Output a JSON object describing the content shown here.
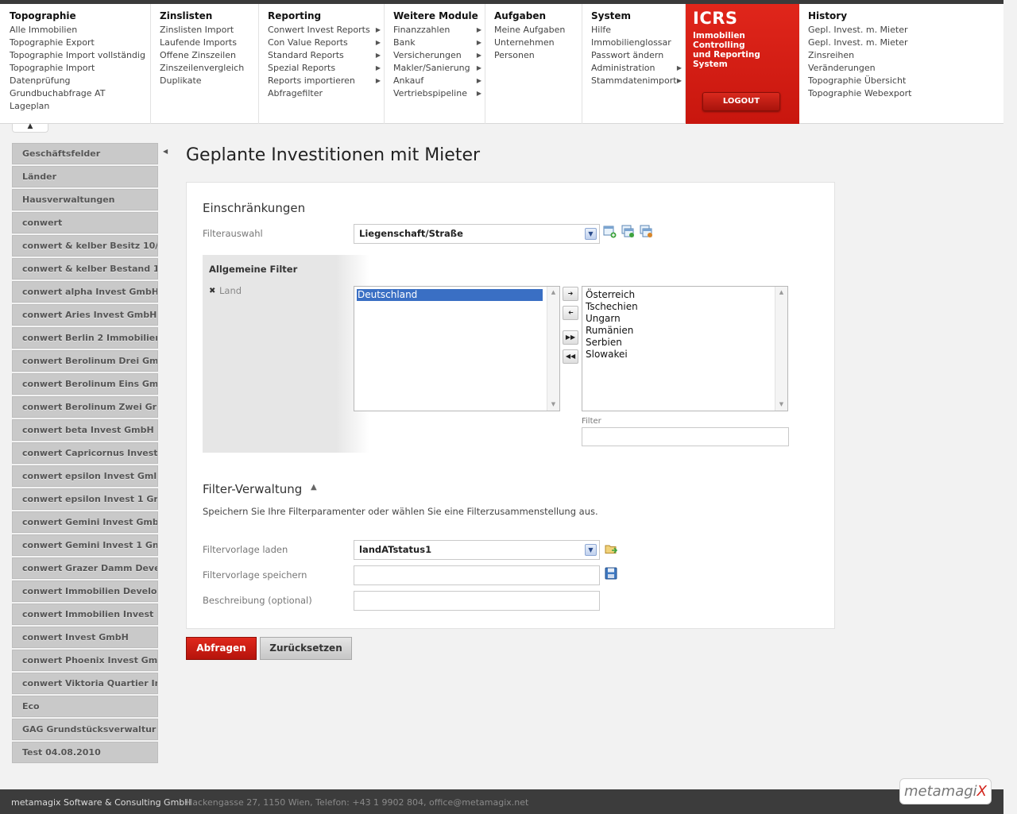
{
  "menu": {
    "topographie": {
      "title": "Topographie",
      "items": [
        "Alle Immobilien",
        "Topographie Export",
        "Topographie Import vollständig",
        "Topographie Import",
        "Datenprüfung",
        "Grundbuchabfrage AT",
        "Lageplan"
      ]
    },
    "zinslisten": {
      "title": "Zinslisten",
      "items": [
        "Zinslisten Import",
        "Laufende Imports",
        "Offene Zinszeilen",
        "Zinszeilenvergleich",
        "Duplikate"
      ]
    },
    "reporting": {
      "title": "Reporting",
      "items": [
        "Conwert Invest Reports",
        "Con Value Reports",
        "Standard Reports",
        "Spezial Reports",
        "Reports importieren",
        "Abfragefilter"
      ]
    },
    "weitere": {
      "title": "Weitere Module",
      "items": [
        "Finanzzahlen",
        "Bank",
        "Versicherungen",
        "Makler/Sanierung",
        "Ankauf",
        "Vertriebspipeline"
      ]
    },
    "aufgaben": {
      "title": "Aufgaben",
      "items": [
        "Meine Aufgaben",
        "Unternehmen",
        "Personen"
      ]
    },
    "system": {
      "title": "System",
      "items": [
        "Hilfe",
        "Immobilienglossar",
        "Passwort ändern",
        "Administration",
        "Stammdatenimport"
      ]
    },
    "history": {
      "title": "History",
      "items": [
        "Gepl. Invest. m. Mieter",
        "Gepl. Invest. m. Mieter",
        "Zinsreihen",
        "Veränderungen",
        "Topographie Übersicht",
        "Topographie Webexport"
      ]
    }
  },
  "icrs": {
    "title": "ICRS",
    "subtitle_line1": "Immobilien Controlling",
    "subtitle_line2": "und Reporting System",
    "logout": "LOGOUT"
  },
  "sidebar": {
    "items": [
      "Geschäftsfelder",
      "Länder",
      "Hausverwaltungen",
      "conwert",
      "conwert & kelber Besitz 10/",
      "conwert & kelber Bestand 1",
      "conwert alpha Invest GmbH",
      "conwert Aries Invest GmbH",
      "conwert Berlin 2 Immobilier",
      "conwert Berolinum Drei Gm",
      "conwert Berolinum Eins Gm",
      "conwert Berolinum Zwei Gr",
      "conwert beta Invest GmbH",
      "conwert Capricornus Invest",
      "conwert epsilon Invest Gml",
      "conwert epsilon Invest 1 Gr",
      "conwert Gemini Invest Gmb",
      "conwert Gemini Invest 1 Gn",
      "conwert Grazer Damm Deve",
      "conwert Immobilien Develo",
      "conwert Immobilien Invest",
      "conwert Invest GmbH",
      "conwert Phoenix Invest Gm",
      "conwert Viktoria Quartier In",
      "Eco",
      "GAG Grundstücksverwaltur",
      "Test 04.08.2010"
    ]
  },
  "page": {
    "title": "Geplante Investitionen mit Mieter"
  },
  "einschraenkungen": {
    "title": "Einschränkungen",
    "filterauswahl_label": "Filterauswahl",
    "filterauswahl_value": "Liegenschaft/Straße",
    "allgemeine_filter": "Allgemeine Filter",
    "land_label": "Land",
    "selected": [
      "Deutschland"
    ],
    "available": [
      "Österreich",
      "Tschechien",
      "Ungarn",
      "Rumänien",
      "Serbien",
      "Slowakei"
    ],
    "filter_label": "Filter"
  },
  "filter_verwaltung": {
    "title": "Filter-Verwaltung",
    "description": "Speichern Sie Ihre Filterparamenter oder wählen Sie eine Filterzusammenstellung aus.",
    "laden_label": "Filtervorlage laden",
    "laden_value": "landATstatus1",
    "speichern_label": "Filtervorlage speichern",
    "beschreibung_label": "Beschreibung (optional)"
  },
  "buttons": {
    "abfragen": "Abfragen",
    "zuruecksetzen": "Zurücksetzen"
  },
  "footer": {
    "company": "metamagix Software & Consulting GmbH",
    "address": "Hackengasse 27, 1150 Wien, Telefon: +43 1 9902 804, office@metamagix.net",
    "logo_main": "metamagi",
    "logo_accent": "X"
  }
}
